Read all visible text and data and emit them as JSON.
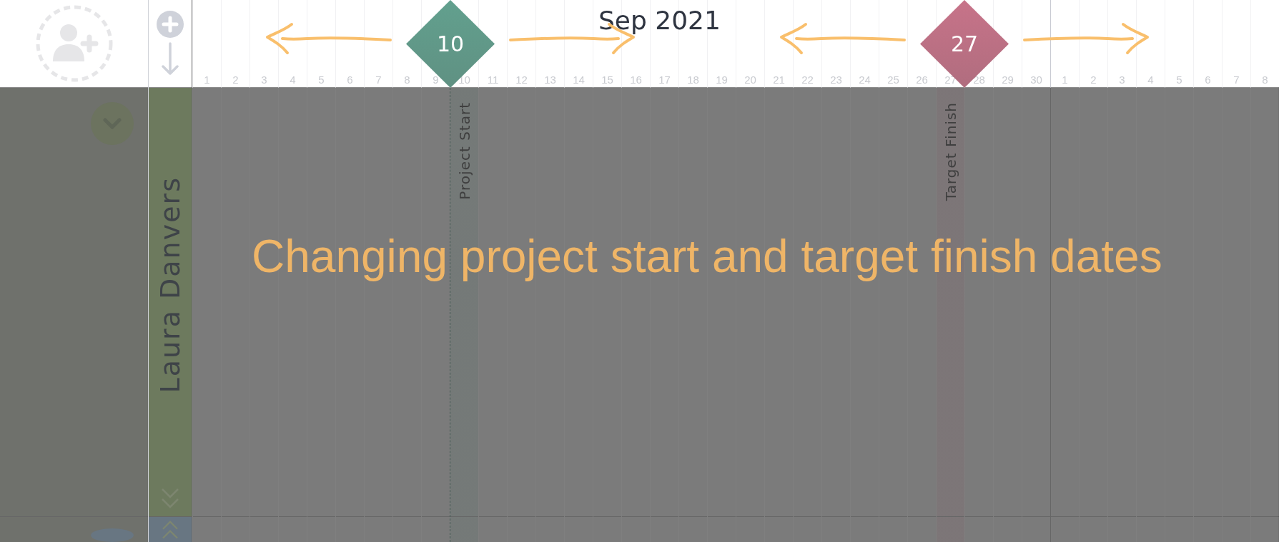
{
  "rows": [
    {
      "name": "Laura Danvers",
      "color": "#6d7a5e"
    },
    {
      "color": "#687682"
    }
  ],
  "months": [
    {
      "label": "Sep 2021",
      "days": [
        {
          "label": "1"
        },
        {
          "label": "2"
        },
        {
          "label": "3"
        },
        {
          "label": "4"
        },
        {
          "label": "5"
        },
        {
          "label": "6"
        },
        {
          "label": "7"
        },
        {
          "label": "8"
        },
        {
          "label": "9"
        },
        {
          "label": "10",
          "marker": {
            "kind": "start",
            "number": "10",
            "label": "Project Start",
            "color": "#62a08e"
          }
        },
        {
          "label": "11"
        },
        {
          "label": "12"
        },
        {
          "label": "13"
        },
        {
          "label": "14"
        },
        {
          "label": "15"
        },
        {
          "label": "16"
        },
        {
          "label": "17"
        },
        {
          "label": "18"
        },
        {
          "label": "19"
        },
        {
          "label": "20"
        },
        {
          "label": "21"
        },
        {
          "label": "22"
        },
        {
          "label": "23"
        },
        {
          "label": "24"
        },
        {
          "label": "25"
        },
        {
          "label": "26"
        },
        {
          "label": "27",
          "marker": {
            "kind": "finish",
            "number": "27",
            "label": "Target Finish",
            "color": "#c77389"
          }
        },
        {
          "label": "28"
        },
        {
          "label": "29"
        },
        {
          "label": "30"
        }
      ]
    },
    {
      "days": [
        {
          "label": "1"
        },
        {
          "label": "2"
        },
        {
          "label": "3"
        },
        {
          "label": "4"
        },
        {
          "label": "5"
        },
        {
          "label": "6"
        },
        {
          "label": "7"
        },
        {
          "label": "8"
        }
      ]
    }
  ],
  "annotation": {
    "text": "Changing project start and target finish dates"
  }
}
